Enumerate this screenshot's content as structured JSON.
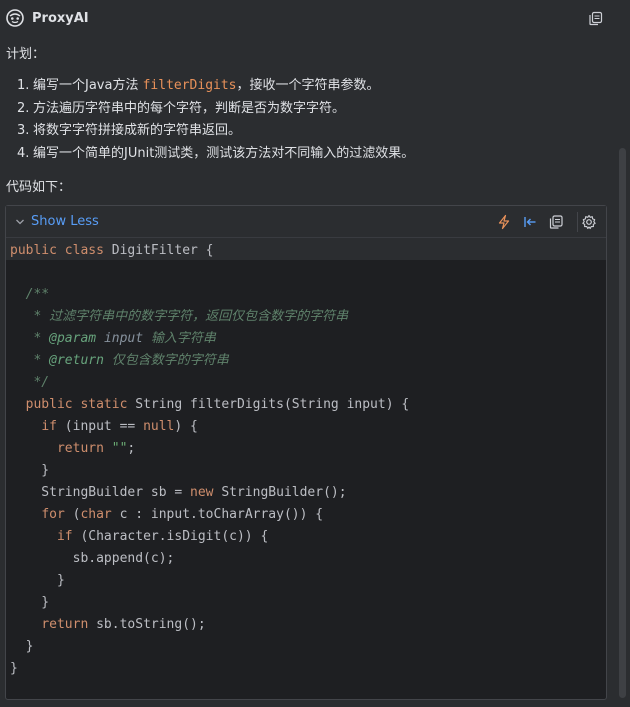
{
  "header": {
    "title": "ProxyAI"
  },
  "message": {
    "plan_label": "计划：",
    "steps": [
      {
        "num": "1.",
        "before": "编写一个Java方法 ",
        "code": "filterDigits",
        "after": "，接收一个字符串参数。"
      },
      {
        "num": "2.",
        "before": "方法遍历字符串中的每个字符，判断是否为数字字符。",
        "code": "",
        "after": ""
      },
      {
        "num": "3.",
        "before": "将数字字符拼接成新的字符串返回。",
        "code": "",
        "after": ""
      },
      {
        "num": "4.",
        "before": "编写一个简单的JUnit测试类，测试该方法对不同输入的过滤效果。",
        "code": "",
        "after": ""
      }
    ],
    "code_label": "代码如下："
  },
  "code_block": {
    "toggle_label": "Show Less",
    "toolbar_icons": [
      "lightning-icon",
      "insert-left-icon",
      "copy-icon",
      "settings-icon"
    ],
    "lines": [
      "public class DigitFilter {",
      "",
      "  /**",
      "   * 过滤字符串中的数字字符，返回仅包含数字的字符串",
      "   * @param input 输入字符串",
      "   * @return 仅包含数字的字符串",
      "   */",
      "  public static String filterDigits(String input) {",
      "    if (input == null) {",
      "      return \"\";",
      "    }",
      "    StringBuilder sb = new StringBuilder();",
      "    for (char c : input.toCharArray()) {",
      "      if (Character.isDigit(c)) {",
      "        sb.append(c);",
      "      }",
      "    }",
      "    return sb.toString();",
      "  }",
      "}"
    ]
  },
  "colors": {
    "background": "#2b2d30",
    "code_background": "#1e1f22",
    "accent_link": "#589df6",
    "keyword": "#cf8e6d",
    "string": "#6aab73",
    "doc_comment": "#5f826b",
    "inline_code": "#e8915a"
  }
}
